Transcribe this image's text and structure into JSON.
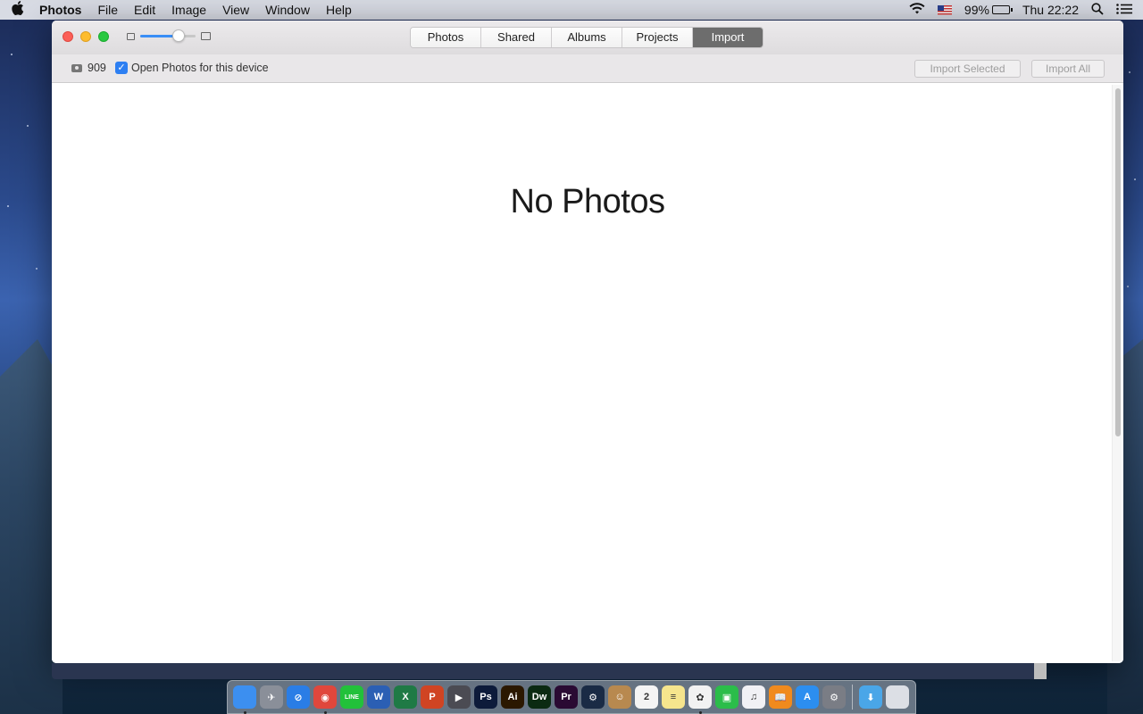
{
  "menubar": {
    "apple_icon": "",
    "app_name": "Photos",
    "items": [
      "File",
      "Edit",
      "Image",
      "View",
      "Window",
      "Help"
    ],
    "battery_percent": "99%",
    "clock": "Thu 22:22"
  },
  "window": {
    "tabs": [
      "Photos",
      "Shared",
      "Albums",
      "Projects",
      "Import"
    ],
    "active_tab": "Import",
    "zoom_level": 0.7,
    "toolbar": {
      "device_count": "909",
      "open_photos_label": "Open Photos for this device",
      "open_photos_checked": true,
      "import_selected_label": "Import Selected",
      "import_all_label": "Import All"
    },
    "empty_message": "No Photos"
  },
  "dock": {
    "apps": [
      {
        "name": "finder-icon",
        "glyph": "",
        "color": "#3c8ff0",
        "running": true
      },
      {
        "name": "launchpad-icon",
        "glyph": "✈",
        "color": "#8a8f99",
        "running": false
      },
      {
        "name": "safari-icon",
        "glyph": "⊘",
        "color": "#2a7de6",
        "running": false
      },
      {
        "name": "chrome-icon",
        "glyph": "◉",
        "color": "#e0473c",
        "running": true
      },
      {
        "name": "line-icon",
        "glyph": "LINE",
        "color": "#22c13a",
        "running": false
      },
      {
        "name": "word-icon",
        "glyph": "W",
        "color": "#2b5fb4",
        "running": false
      },
      {
        "name": "excel-icon",
        "glyph": "X",
        "color": "#1f7a45",
        "running": false
      },
      {
        "name": "powerpoint-icon",
        "glyph": "P",
        "color": "#d04423",
        "running": false
      },
      {
        "name": "final-cut-icon",
        "glyph": "▶",
        "color": "#4b4b53",
        "running": false
      },
      {
        "name": "photoshop-icon",
        "glyph": "Ps",
        "color": "#0d1b3a",
        "running": false
      },
      {
        "name": "illustrator-icon",
        "glyph": "Ai",
        "color": "#2b1800",
        "running": false
      },
      {
        "name": "dreamweaver-icon",
        "glyph": "Dw",
        "color": "#0b2a12",
        "running": false
      },
      {
        "name": "premiere-icon",
        "glyph": "Pr",
        "color": "#2a0a33",
        "running": false
      },
      {
        "name": "steam-icon",
        "glyph": "⚙",
        "color": "#1a2b45",
        "running": false
      },
      {
        "name": "contacts-icon",
        "glyph": "☺",
        "color": "#b8894f",
        "running": false
      },
      {
        "name": "calendar-icon",
        "glyph": "2",
        "color": "#f4f4f4",
        "running": false
      },
      {
        "name": "notes-icon",
        "glyph": "≡",
        "color": "#f6e58d",
        "running": false
      },
      {
        "name": "photos-icon",
        "glyph": "✿",
        "color": "#f2f2f2",
        "running": true
      },
      {
        "name": "facetime-icon",
        "glyph": "▣",
        "color": "#2bbd4a",
        "running": false
      },
      {
        "name": "itunes-icon",
        "glyph": "♫",
        "color": "#f1f1f5",
        "running": false
      },
      {
        "name": "ibooks-icon",
        "glyph": "📖",
        "color": "#f08a1e",
        "running": false
      },
      {
        "name": "app-store-icon",
        "glyph": "A",
        "color": "#2c8ef0",
        "running": false
      },
      {
        "name": "system-preferences-icon",
        "glyph": "⚙",
        "color": "#7a7d85",
        "running": false
      }
    ],
    "stacks": [
      {
        "name": "downloads-folder-icon",
        "glyph": "⬇",
        "color": "#4aa6e8"
      },
      {
        "name": "trash-icon",
        "glyph": "",
        "color": "#dcdfe5"
      }
    ]
  }
}
